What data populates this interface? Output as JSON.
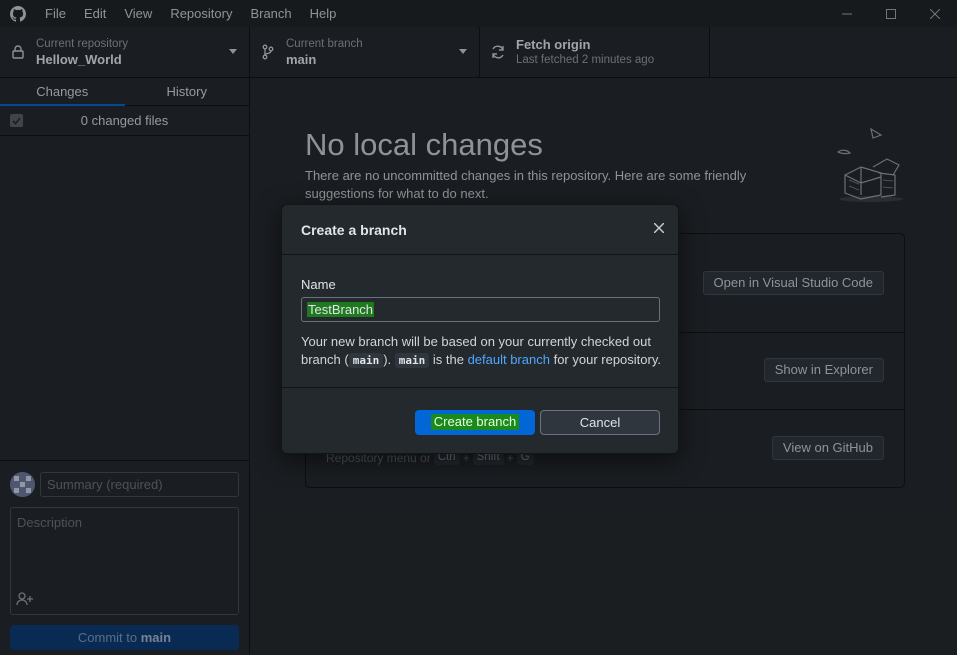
{
  "menu": [
    "File",
    "Edit",
    "View",
    "Repository",
    "Branch",
    "Help"
  ],
  "toolbar": {
    "repo_label": "Current repository",
    "repo_name": "Hellow_World",
    "branch_label": "Current branch",
    "branch_name": "main",
    "fetch_title": "Fetch origin",
    "fetch_status": "Last fetched 2 minutes ago"
  },
  "sidebar": {
    "tabs": [
      "Changes",
      "History"
    ],
    "changed_files": "0 changed files",
    "summary_placeholder": "Summary (required)",
    "description_placeholder": "Description",
    "commit_prefix": "Commit to",
    "commit_branch": "main"
  },
  "main": {
    "title": "No local changes",
    "description": "There are no uncommitted changes in this repository. Here are some friendly suggestions for what to do next.",
    "suggestions": [
      {
        "button": "Open in Visual Studio Code"
      },
      {
        "button": "Show in Explorer"
      },
      {
        "button": "View on GitHub"
      }
    ],
    "hint_text": "Repository menu or",
    "hint_keys": [
      "Ctrl",
      "Shift",
      "G"
    ],
    "hint_sep": "+"
  },
  "dialog": {
    "title": "Create a branch",
    "name_label": "Name",
    "name_value": "TestBranch",
    "help_1": "Your new branch will be based on your currently checked out branch (",
    "help_code_1": "main",
    "help_2": "). ",
    "help_code_2": "main",
    "help_3": " is the ",
    "help_link": "default branch",
    "help_4": " for your repository.",
    "create_label": "Create branch",
    "cancel_label": "Cancel"
  },
  "colors": {
    "background": "#24292e",
    "accent": "#0366d6",
    "link": "#4fa6ff",
    "highlight": "#1a8a1a"
  }
}
